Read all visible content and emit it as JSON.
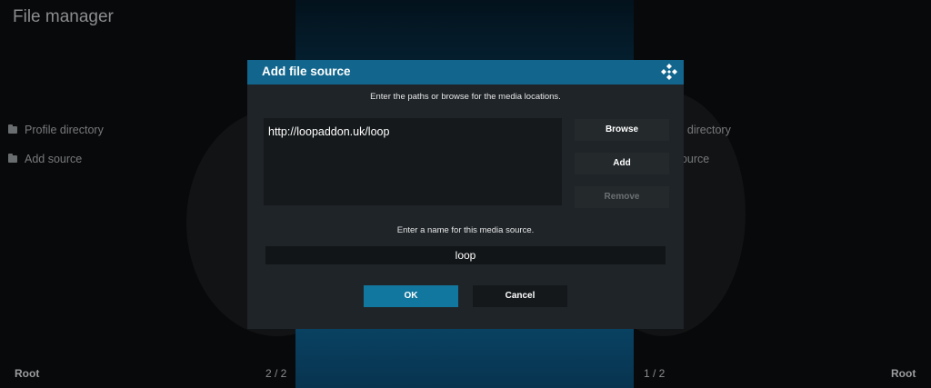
{
  "app": {
    "title": "File manager"
  },
  "left_pane": {
    "items": [
      {
        "label": "Profile directory",
        "icon": "folder-icon"
      },
      {
        "label": "Add source",
        "icon": "folder-icon"
      }
    ],
    "footer_path": "Root",
    "footer_count": "2 / 2"
  },
  "right_pane": {
    "items": [
      {
        "label": "Profile directory",
        "icon": "folder-icon"
      },
      {
        "label": "Add source",
        "icon": "folder-icon"
      }
    ],
    "footer_path": "Root",
    "footer_count": "1 / 2"
  },
  "dialog": {
    "title": "Add file source",
    "paths_instruction": "Enter the paths or browse for the media locations.",
    "paths": [
      "http://loopaddon.uk/loop"
    ],
    "buttons": {
      "browse": "Browse",
      "add": "Add",
      "remove": "Remove"
    },
    "name_instruction": "Enter a name for this media source.",
    "name_value": "loop",
    "ok_label": "OK",
    "cancel_label": "Cancel"
  },
  "colors": {
    "header": "#12668d",
    "ok_button": "#12779e",
    "dialog_bg": "#1f2428"
  }
}
